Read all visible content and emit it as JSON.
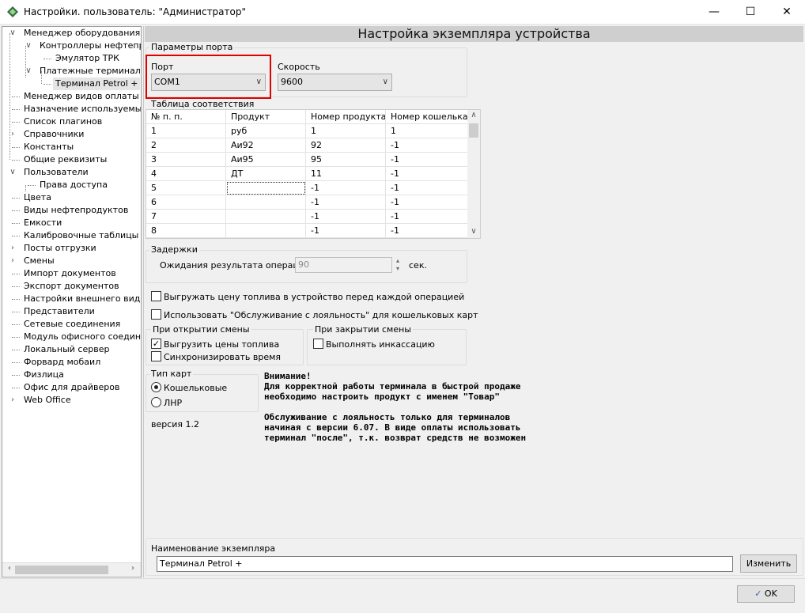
{
  "window": {
    "title": "Настройки. пользователь: \"Администратор\"",
    "minimize": "—",
    "maximize": "☐",
    "close": "✕"
  },
  "tree": {
    "items": [
      {
        "label": "Менеджер оборудования",
        "toggle": "∨"
      },
      {
        "label": "Контроллеры нефтепрод",
        "toggle": "∨"
      },
      {
        "label": "Эмулятор ТРК",
        "toggle": ""
      },
      {
        "label": "Платежные терминалы",
        "toggle": "∨"
      },
      {
        "label": "Терминал Petrol +",
        "toggle": ""
      },
      {
        "label": "Менеджер видов оплаты",
        "toggle": ""
      },
      {
        "label": "Назначение используемых уст",
        "toggle": ""
      },
      {
        "label": "Список плагинов",
        "toggle": ""
      },
      {
        "label": "Справочники",
        "toggle": "›"
      },
      {
        "label": "Константы",
        "toggle": ""
      },
      {
        "label": "Общие реквизиты",
        "toggle": ""
      },
      {
        "label": "Пользователи",
        "toggle": "∨"
      },
      {
        "label": "Права доступа",
        "toggle": ""
      },
      {
        "label": "Цвета",
        "toggle": ""
      },
      {
        "label": "Виды нефтепродуктов",
        "toggle": ""
      },
      {
        "label": "Емкости",
        "toggle": ""
      },
      {
        "label": "Калибровочные таблицы",
        "toggle": ""
      },
      {
        "label": "Посты отгрузки",
        "toggle": "›"
      },
      {
        "label": "Смены",
        "toggle": "›"
      },
      {
        "label": "Импорт документов",
        "toggle": ""
      },
      {
        "label": "Экспорт документов",
        "toggle": ""
      },
      {
        "label": "Настройки внешнего вида",
        "toggle": ""
      },
      {
        "label": "Представители",
        "toggle": ""
      },
      {
        "label": "Сетевые соединения",
        "toggle": ""
      },
      {
        "label": "Модуль офисного соединения",
        "toggle": ""
      },
      {
        "label": "Локальный сервер",
        "toggle": ""
      },
      {
        "label": "Форвард мобаил",
        "toggle": ""
      },
      {
        "label": "Физлица",
        "toggle": ""
      },
      {
        "label": "Офис для драйверов",
        "toggle": ""
      },
      {
        "label": "Web Office",
        "toggle": "›"
      }
    ],
    "scroll_left": "‹",
    "scroll_right": "›"
  },
  "header": {
    "title": "Настройка экземпляра устройства"
  },
  "port_params": {
    "group_label": "Параметры порта",
    "port_label": "Порт",
    "port_value": "COM1",
    "speed_label": "Скорость",
    "speed_value": "9600",
    "chevron": "∨"
  },
  "mapping": {
    "group_label": "Таблица соответствия",
    "columns": [
      "№ п. п.",
      "Продукт",
      "Номер продукта",
      "Номер кошелька"
    ],
    "rows": [
      [
        "1",
        "руб",
        "1",
        "1"
      ],
      [
        "2",
        "Аи92",
        "92",
        "-1"
      ],
      [
        "3",
        "Аи95",
        "95",
        "-1"
      ],
      [
        "4",
        "ДТ",
        "11",
        "-1"
      ],
      [
        "5",
        "",
        "-1",
        "-1"
      ],
      [
        "6",
        "",
        "-1",
        "-1"
      ],
      [
        "7",
        "",
        "-1",
        "-1"
      ],
      [
        "8",
        "",
        "-1",
        "-1"
      ]
    ],
    "scroll_up": "∧",
    "scroll_down": "∨"
  },
  "delays": {
    "group_label": "Задержки",
    "wait_label": "Ожидания результата операции",
    "wait_value": "90",
    "unit": "сек.",
    "spin_up": "▴",
    "spin_down": "▾"
  },
  "options": {
    "upload_prices_label": "Выгружать цену топлива в устройство перед каждой операцией",
    "upload_prices_checked": false,
    "loyalty_label": "Использовать \"Обслуживание с лояльность\" для кошельковых карт",
    "loyalty_checked": false
  },
  "shift_open": {
    "group_label": "При открытии смены",
    "upload_fuel_label": "Выгрузить цены топлива",
    "upload_fuel_check": "✓",
    "sync_time_label": "Синхронизировать время"
  },
  "shift_close": {
    "group_label": "При закрытии смены",
    "collect_label": "Выполнять инкассацию"
  },
  "card_type": {
    "group_label": "Тип карт",
    "wallet_label": "Кошельковые",
    "lnr_label": "ЛНР",
    "selected": "Кошельковые"
  },
  "version": "версия 1.2",
  "notice": {
    "line1": "Внимание!",
    "line2": "Для корректной работы терминала в быстрой продаже",
    "line3": "необходимо настроить продукт с именем \"Товар\"",
    "line4": "Обслуживание с лояльность только для терминалов",
    "line5": "начиная с версии 6.07. В виде оплаты использовать",
    "line6": "терминал \"после\", т.к. возврат средств не возможен"
  },
  "instance": {
    "group_label": "Наименование экземпляра",
    "name_value": "Терминал Petrol +",
    "change_button": "Изменить"
  },
  "footer": {
    "ok_label": "OK"
  },
  "colors": {
    "highlight": "#e00000",
    "header_bg": "#cfcfcf"
  }
}
